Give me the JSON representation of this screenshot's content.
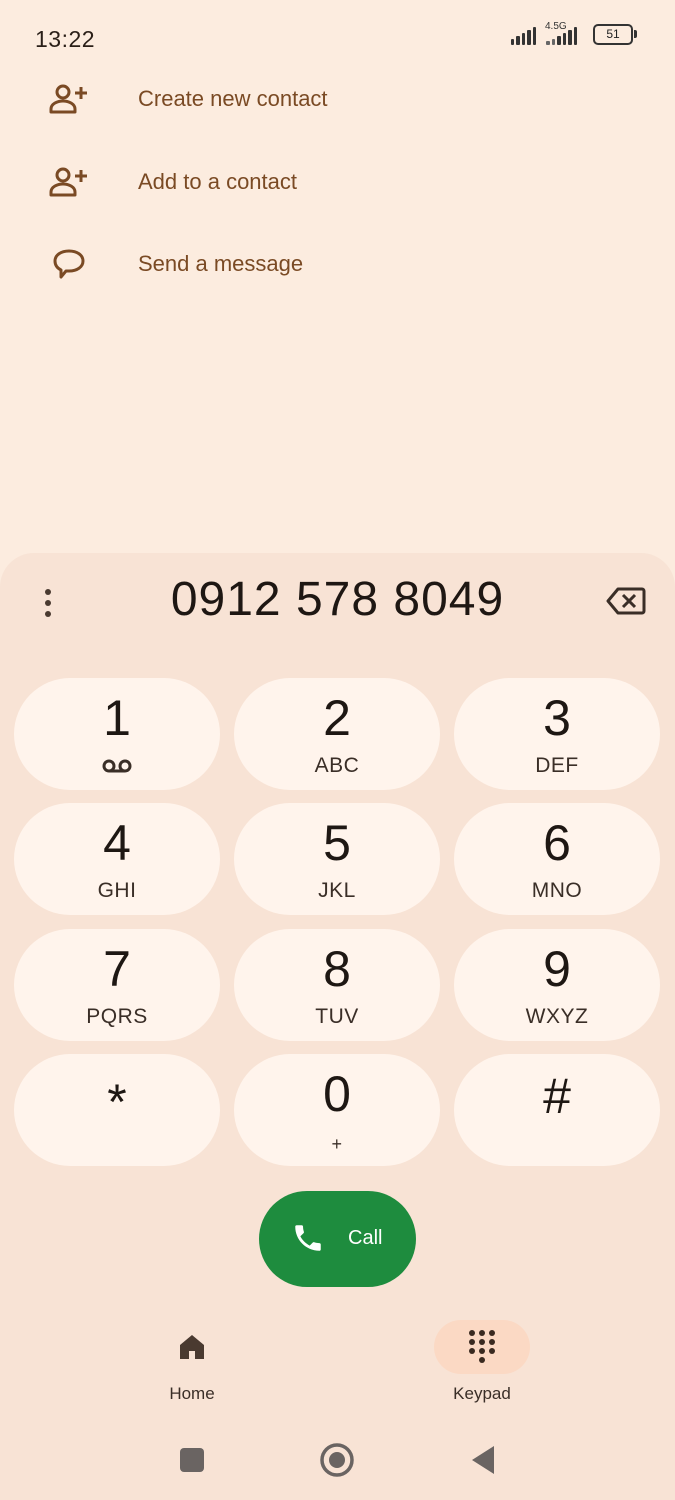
{
  "status": {
    "time": "13:22",
    "network": "4.5G",
    "battery": "51"
  },
  "actions": [
    {
      "label": "Create new contact",
      "icon": "add-person-icon"
    },
    {
      "label": "Add to a contact",
      "icon": "add-person-icon"
    },
    {
      "label": "Send a message",
      "icon": "message-icon"
    }
  ],
  "dialer": {
    "number": "0912 578 8049",
    "keys": [
      {
        "digit": "1",
        "letters": ""
      },
      {
        "digit": "2",
        "letters": "ABC"
      },
      {
        "digit": "3",
        "letters": "DEF"
      },
      {
        "digit": "4",
        "letters": "GHI"
      },
      {
        "digit": "5",
        "letters": "JKL"
      },
      {
        "digit": "6",
        "letters": "MNO"
      },
      {
        "digit": "7",
        "letters": "PQRS"
      },
      {
        "digit": "8",
        "letters": "TUV"
      },
      {
        "digit": "9",
        "letters": "WXYZ"
      },
      {
        "digit": "*",
        "letters": ""
      },
      {
        "digit": "0",
        "letters": "+"
      },
      {
        "digit": "#",
        "letters": ""
      }
    ],
    "call_label": "Call"
  },
  "bottom_nav": {
    "home_label": "Home",
    "keypad_label": "Keypad",
    "active": "Keypad"
  },
  "colors": {
    "background": "#fcecdf",
    "panel": "#f8e3d5",
    "key": "#fff4ec",
    "call": "#1e8c3e",
    "accent_text": "#7a4a24"
  }
}
